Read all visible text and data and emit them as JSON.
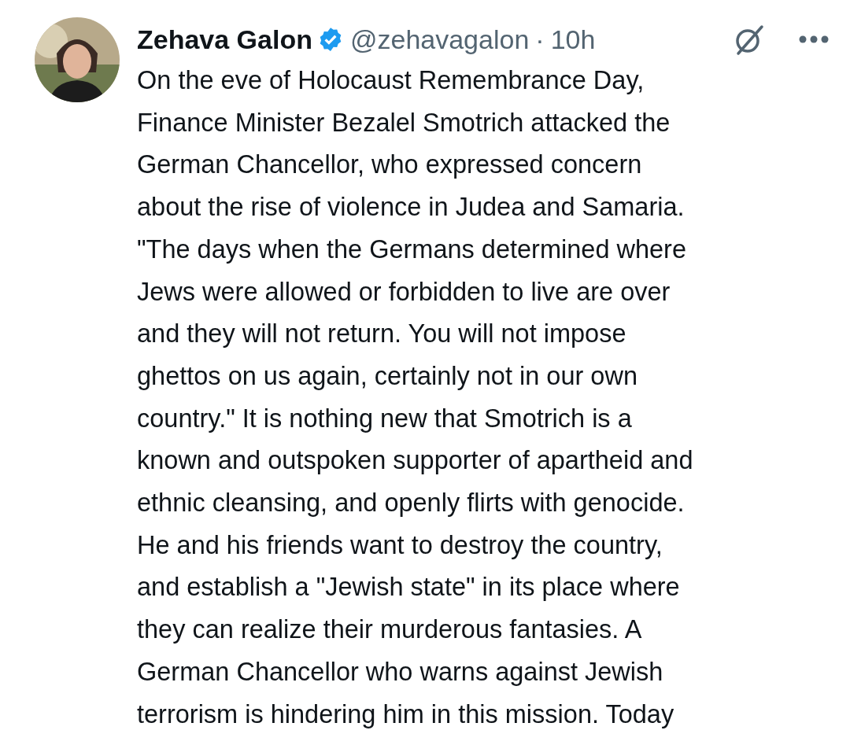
{
  "tweet": {
    "name": "Zehava Galon",
    "verified": true,
    "handle": "@zehavagalon",
    "separator": "·",
    "time": "10h",
    "text_lines": [
      "On the eve of Holocaust Remembrance Day,",
      "Finance Minister Bezalel Smotrich attacked the",
      "German Chancellor, who expressed concern",
      "about the rise of violence in Judea and Samaria.",
      "\"The days when the Germans determined where",
      "Jews were allowed or forbidden to live are over",
      "and they will not return. You will not impose",
      "ghettos on us again, certainly not in our own",
      "country.\" It is nothing new that Smotrich is a",
      "known and outspoken supporter of apartheid and",
      "ethnic cleansing, and openly flirts with genocide.",
      "He and his friends want to destroy the country,",
      "and establish a \"Jewish state\" in its place where",
      "they can realize their murderous fantasies. A",
      "German Chancellor who warns against Jewish",
      "terrorism is hindering him in this mission. Today"
    ]
  }
}
